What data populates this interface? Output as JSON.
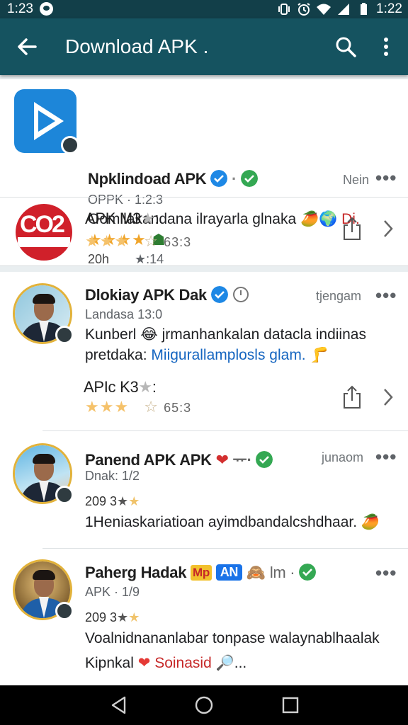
{
  "status_bar": {
    "time_left": "1:23",
    "time_right": "1:22"
  },
  "app_bar": {
    "title": "Download APK ."
  },
  "items": [
    {
      "name": "Npklindoad APK",
      "meta": "OPPK · 1:2:3",
      "time": "Nein",
      "body": "Oomilakandana ilrayarla glnaka",
      "body_suffix": "Di.",
      "stats_left": "20h",
      "stats_right": "★:14"
    },
    {
      "name": "APK M3",
      "rating": "63:3"
    },
    {
      "name": "Dlokiay APK Dak",
      "meta": "Landasa 13:0",
      "time": "tjengam",
      "body_line1": "Kunberl 😂 jrmanhankalan datacla indiinas",
      "body_line2_prefix": "pretdaka:",
      "body_line2_link": "Miigurallamplosls glam.",
      "sub_name": "APIc K3",
      "rating": "65:3"
    },
    {
      "name": "Panend APK APK",
      "meta": "Dnak: 1/2",
      "time": "junaom",
      "stats": "209 3",
      "body": "1Heniaskariatioan ayimdbandalcshdhaar."
    },
    {
      "name": "Paherg Hadak",
      "tag_y": "Mp",
      "tag_an": "AN",
      "after_tags": "lm ·",
      "meta": "APK · 1/9",
      "stats": "209 3",
      "body_line1": "Voalnidnananlabar tonpase walaynablhaalak",
      "body_line2_prefix": "Kipnkal",
      "body_line2_red": "Soinasid",
      "body_line2_suffix": "..."
    }
  ],
  "colors": {
    "status_bar": "#123f49",
    "app_bar": "#155360",
    "verified_blue": "#1e88e5",
    "verified_green": "#34a853",
    "star": "#f0a52b",
    "link": "#1565c0"
  },
  "icons": [
    "back-arrow-icon",
    "search-icon",
    "overflow-menu-icon",
    "share-icon",
    "chevron-right-icon",
    "verified-icon",
    "star-icon",
    "back-nav-icon",
    "home-nav-icon",
    "recents-nav-icon"
  ]
}
